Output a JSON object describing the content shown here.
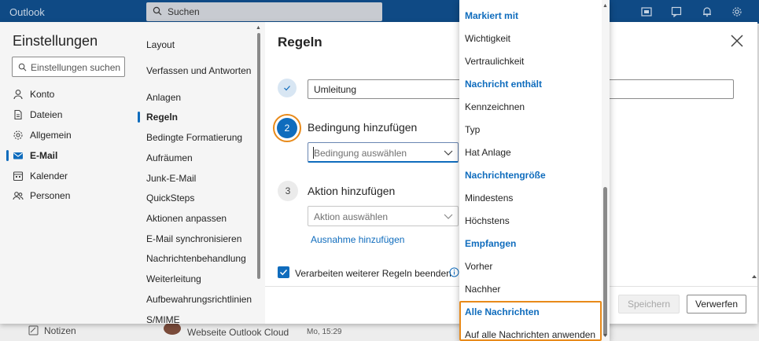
{
  "app": {
    "title": "Outlook",
    "search_placeholder": "Suchen"
  },
  "nav1": {
    "title": "Einstellungen",
    "search_placeholder": "Einstellungen suchen",
    "items": [
      {
        "label": "Konto",
        "icon": "person-icon"
      },
      {
        "label": "Dateien",
        "icon": "file-icon"
      },
      {
        "label": "Allgemein",
        "icon": "gear-icon"
      },
      {
        "label": "E-Mail",
        "icon": "mail-icon",
        "active": true
      },
      {
        "label": "Kalender",
        "icon": "calendar-icon"
      },
      {
        "label": "Personen",
        "icon": "people-icon"
      }
    ]
  },
  "nav2": {
    "items": [
      "Layout",
      "Verfassen und Antworten",
      "Anlagen",
      "Regeln",
      "Bedingte Formatierung",
      "Aufräumen",
      "Junk-E-Mail",
      "QuickSteps",
      "Aktionen anpassen",
      "E-Mail synchronisieren",
      "Nachrichtenbehandlung",
      "Weiterleitung",
      "Aufbewahrungsrichtlinien",
      "S/MIME"
    ],
    "active": "Regeln"
  },
  "main": {
    "title": "Regeln",
    "rule_name": "Umleitung",
    "step2_number": "2",
    "step2_label": "Bedingung hinzufügen",
    "condition_placeholder": "Bedingung auswählen",
    "step3_number": "3",
    "step3_label": "Aktion hinzufügen",
    "action_placeholder": "Aktion auswählen",
    "exception_link": "Ausnahme hinzufügen",
    "stop_processing_label": "Verarbeiten weiterer Regeln beenden",
    "stop_processing_checked": true,
    "save_label": "Speichern",
    "discard_label": "Verwerfen"
  },
  "dropdown": {
    "rows": [
      {
        "label": "Markiert mit",
        "header": true
      },
      {
        "label": "Wichtigkeit"
      },
      {
        "label": "Vertraulichkeit"
      },
      {
        "label": "Nachricht enthält",
        "header": true
      },
      {
        "label": "Kennzeichnen"
      },
      {
        "label": "Typ"
      },
      {
        "label": "Hat Anlage"
      },
      {
        "label": "Nachrichtengröße",
        "header": true
      },
      {
        "label": "Mindestens"
      },
      {
        "label": "Höchstens"
      },
      {
        "label": "Empfangen",
        "header": true
      },
      {
        "label": "Vorher"
      },
      {
        "label": "Nachher"
      },
      {
        "label": "Alle Nachrichten",
        "header": true
      },
      {
        "label": "Auf alle Nachrichten anwenden"
      }
    ]
  },
  "background": {
    "notes_label": "Notizen",
    "mail_sender": "Webseite Outlook Cloud",
    "mail_time": "Mo, 15:29"
  },
  "colors": {
    "brand": "#0f4a85",
    "accent": "#0f6cbd",
    "highlight": "#e88a1a"
  }
}
